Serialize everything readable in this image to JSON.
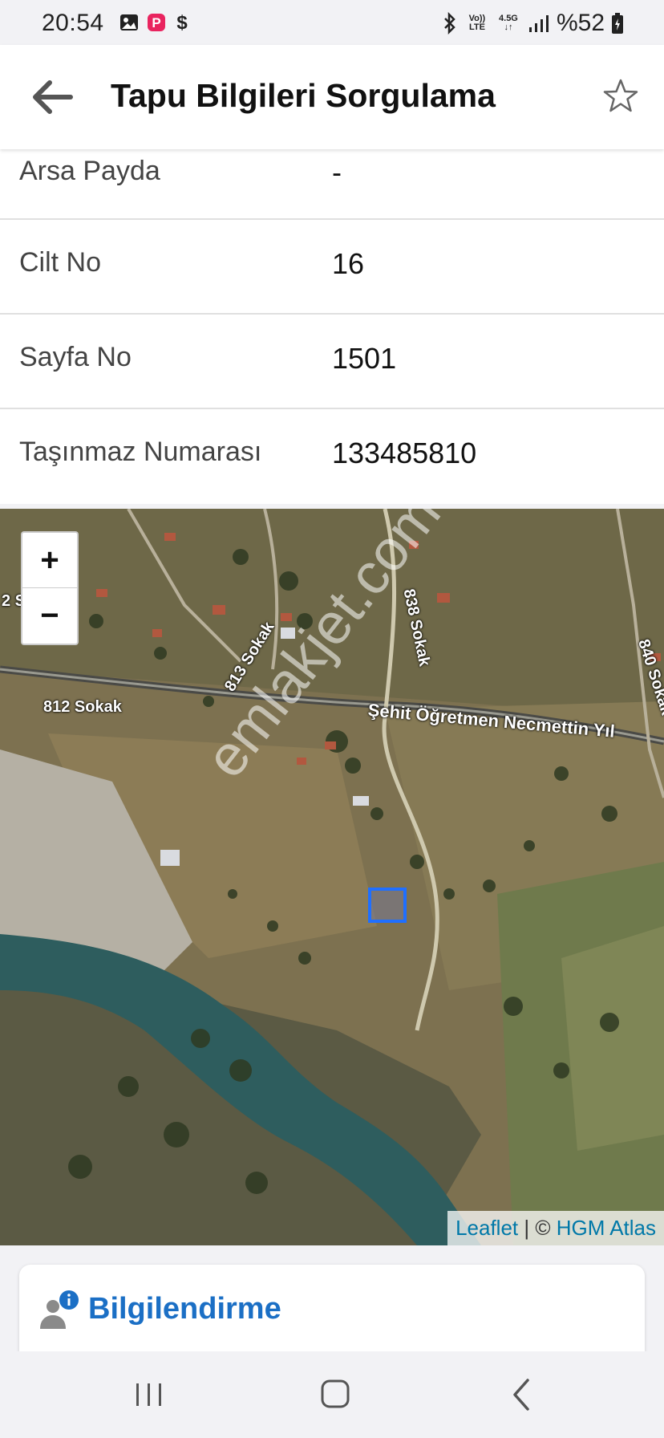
{
  "status_bar": {
    "time": "20:54",
    "battery": "%52",
    "network_top": "4.5G",
    "volte_top": "Vo))",
    "volte_bottom": "LTE"
  },
  "app_bar": {
    "title": "Tapu Bilgileri Sorgulama"
  },
  "rows": [
    {
      "label": "Arsa Payda",
      "value": "-"
    },
    {
      "label": "Cilt No",
      "value": "16"
    },
    {
      "label": "Sayfa No",
      "value": "1501"
    },
    {
      "label": "Taşınmaz Numarası",
      "value": "133485810"
    }
  ],
  "map": {
    "zoom_in": "+",
    "zoom_out": "−",
    "attribution_leaflet": "Leaflet",
    "attribution_sep": " | © ",
    "attribution_source": "HGM Atlas",
    "watermark": "emlakjet.com",
    "streets": {
      "s812": "812 Sokak",
      "s813": "813 Sokak",
      "s838": "838 Sokak",
      "s840": "840 Sokak",
      "main": "Şehit Öğretmen Necmettin Yıl",
      "s2": "2 S"
    }
  },
  "info_card": {
    "title": "Bilgilendirme"
  },
  "colors": {
    "accent": "#1b6fc5",
    "parcel": "#1f6fff",
    "attribution_link": "#0078a8"
  }
}
